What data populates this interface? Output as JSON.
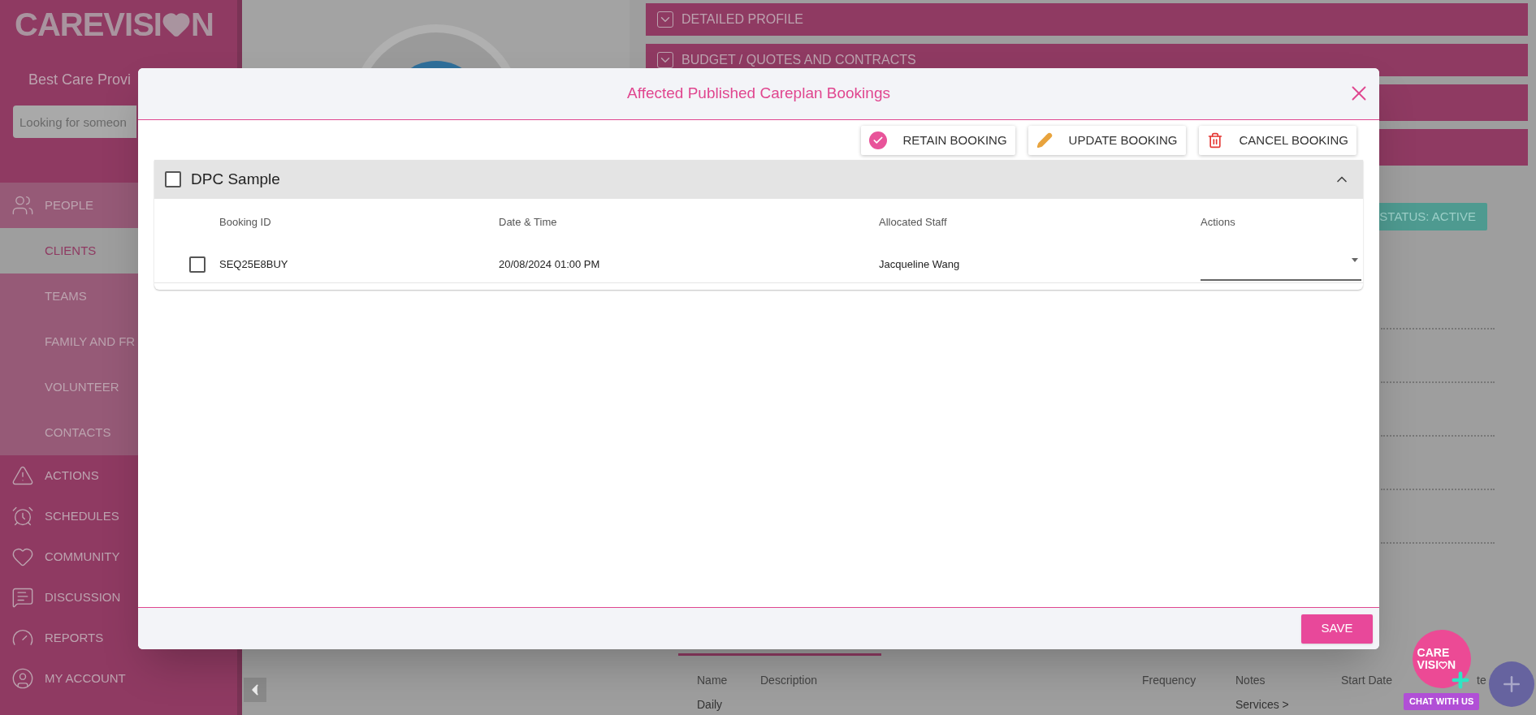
{
  "sidebar": {
    "logo": {
      "before": "CAREVISI",
      "after": "N"
    },
    "organisation": "Best Care Provi",
    "search": {
      "placeholder": "Looking for someon"
    },
    "items": [
      {
        "label": "PEOPLE",
        "kind": "people",
        "selected": false,
        "children": [
          {
            "label": "CLIENTS",
            "selected": true
          },
          {
            "label": "TEAMS",
            "selected": false
          },
          {
            "label": "FAMILY AND FR",
            "selected": false
          },
          {
            "label": "VOLUNTEER",
            "selected": false
          },
          {
            "label": "CONTACTS",
            "selected": false
          }
        ]
      },
      {
        "label": "ACTIONS",
        "kind": "warning",
        "selected": false
      },
      {
        "label": "SCHEDULES",
        "kind": "clock",
        "selected": false
      },
      {
        "label": "COMMUNITY",
        "kind": "heart",
        "selected": false
      },
      {
        "label": "DISCUSSION",
        "kind": "chat",
        "selected": false
      },
      {
        "label": "REPORTS",
        "kind": "gauge",
        "selected": false
      },
      {
        "label": "MY ACCOUNT",
        "kind": "user",
        "selected": false
      }
    ]
  },
  "profile_sections": [
    "DETAILED PROFILE",
    "BUDGET / QUOTES AND CONTRACTS"
  ],
  "status_button": "STATUS: ACTIVE",
  "plans_table": {
    "columns": [
      "Name",
      "Description",
      "Frequency",
      "Notes",
      "Start Date",
      "te"
    ],
    "rows": [
      {
        "name": "Daily",
        "notes": "Services >"
      }
    ]
  },
  "chat_widget": {
    "logo_top": "CARE",
    "logo_before": "VISI",
    "logo_after": "N",
    "label": "CHAT WITH US"
  },
  "dialog": {
    "title": "Affected Published Careplan Bookings",
    "toolbar": [
      {
        "kind": "retain",
        "label": "RETAIN BOOKING"
      },
      {
        "kind": "update",
        "label": "UPDATE BOOKING"
      },
      {
        "kind": "cancel",
        "label": "CANCEL BOOKING"
      }
    ],
    "groups": [
      {
        "name": "DPC Sample",
        "checked": false,
        "expanded": true,
        "columns": [
          "Booking ID",
          "Date & Time",
          "Allocated Staff",
          "Actions"
        ],
        "rows": [
          {
            "booking_id": "SEQ25E8BUY",
            "date_time": "20/08/2024 01:00 PM",
            "staff": "Jacqueline Wang",
            "checked": false
          }
        ]
      }
    ]
  },
  "save_button": "SAVE"
}
